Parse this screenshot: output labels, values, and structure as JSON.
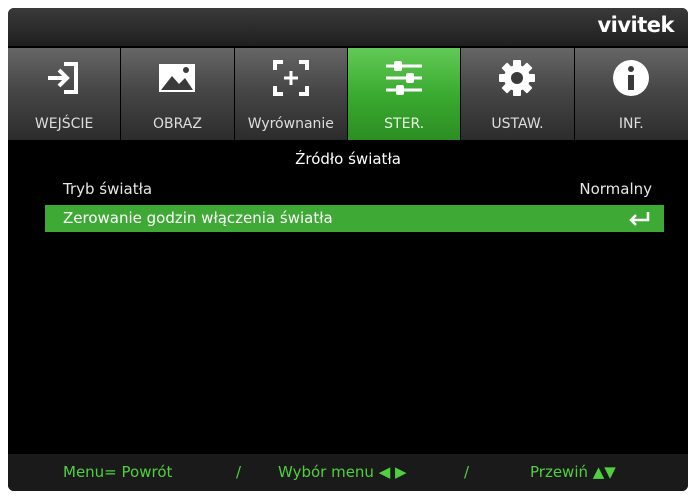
{
  "brand": "vivitek",
  "tabs": [
    {
      "label": "WEJŚCIE",
      "icon": "input-icon"
    },
    {
      "label": "OBRAZ",
      "icon": "image-icon"
    },
    {
      "label": "Wyrównanie",
      "icon": "alignment-icon"
    },
    {
      "label": "STER.",
      "icon": "sliders-icon",
      "active": true
    },
    {
      "label": "USTAW.",
      "icon": "gear-icon"
    },
    {
      "label": "INF.",
      "icon": "info-icon"
    }
  ],
  "section_title": "Źródło światła",
  "rows": [
    {
      "label": "Tryb światła",
      "value": "Normalny"
    },
    {
      "label": "Zerowanie godzin włączenia światła",
      "value": "↵",
      "selected": true
    }
  ],
  "footer": {
    "back": "Menu= Powrót",
    "sep1": "/",
    "select": "Wybór menu ◀ ▶",
    "sep2": "/",
    "scroll": "Przewiń ▲▼"
  },
  "colors": {
    "accent": "#3fa935",
    "footer_text": "#4fd03f"
  }
}
